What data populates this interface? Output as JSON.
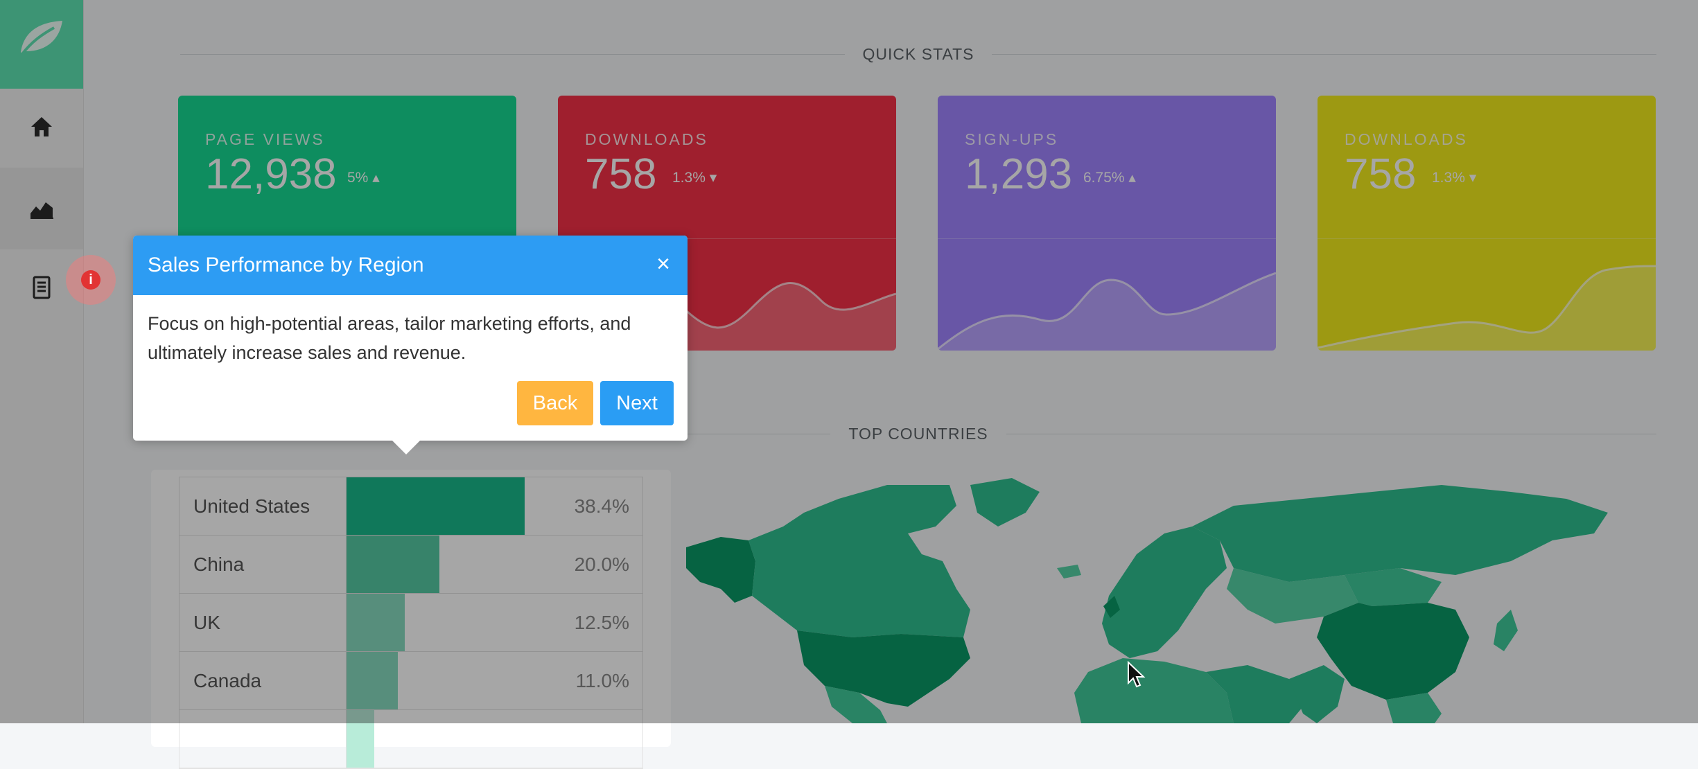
{
  "sidebar": {
    "items": [
      {
        "name": "home",
        "icon": "home-icon"
      },
      {
        "name": "charts",
        "icon": "area-chart-icon"
      },
      {
        "name": "reports",
        "icon": "document-icon"
      }
    ],
    "logo_icon": "leaf-icon"
  },
  "quick_stats": {
    "title": "QUICK STATS",
    "cards": [
      {
        "label": "PAGE VIEWS",
        "value": "12,938",
        "change": "5%",
        "direction": "up",
        "color": "#16d993"
      },
      {
        "label": "DOWNLOADS",
        "value": "758",
        "change": "1.3%",
        "direction": "down",
        "color": "#f53147"
      },
      {
        "label": "SIGN-UPS",
        "value": "1,293",
        "change": "6.75%",
        "direction": "up",
        "color": "#a084ff"
      },
      {
        "label": "DOWNLOADS",
        "value": "758",
        "change": "1.3%",
        "direction": "down",
        "color": "#f2ec1d"
      }
    ]
  },
  "top_countries": {
    "title": "TOP COUNTRIES",
    "rows": [
      {
        "name": "United States",
        "pct": "38.4%",
        "value": 38.4,
        "color": "#1ab98a"
      },
      {
        "name": "China",
        "pct": "20.0%",
        "value": 20.0,
        "color": "#55c9a4"
      },
      {
        "name": "UK",
        "pct": "12.5%",
        "value": 12.5,
        "color": "#86dbbf"
      },
      {
        "name": "Canada",
        "pct": "11.0%",
        "value": 11.0,
        "color": "#86dbbf"
      },
      {
        "name": "",
        "pct": "",
        "value": 6.0,
        "color": "#b8ecd9"
      }
    ]
  },
  "tour": {
    "title": "Sales Performance by Region",
    "body": "Focus on high-potential areas, tailor marketing efforts, and ultimately increase sales and revenue.",
    "back_label": "Back",
    "next_label": "Next",
    "close_icon": "close-icon",
    "hotspot_label": "i"
  },
  "colors": {
    "overlay": "rgba(0,0,0,0.35)",
    "accent": "#2d9cf3"
  }
}
